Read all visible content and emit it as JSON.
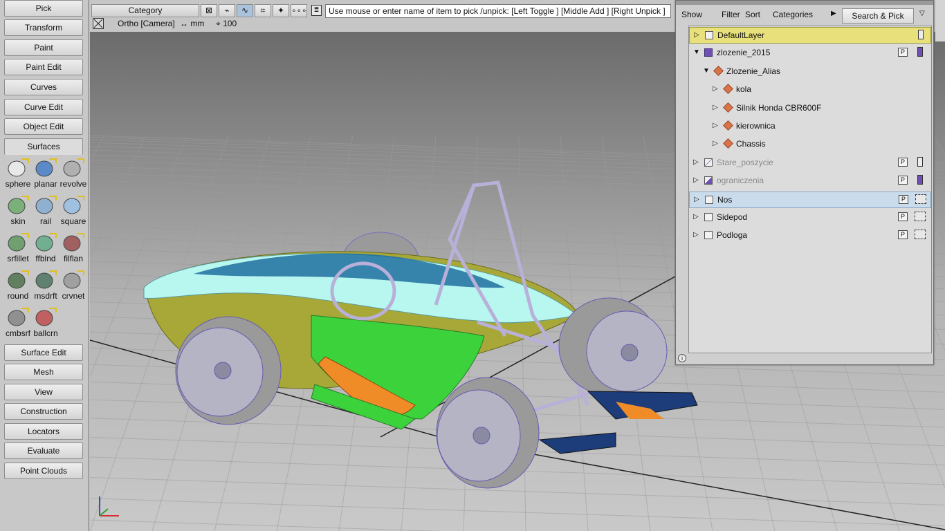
{
  "palette": {
    "buttons": [
      "Pick",
      "Transform",
      "Paint",
      "Paint Edit",
      "Curves",
      "Curve Edit",
      "Object Edit",
      "Surfaces",
      "Surface Edit",
      "Mesh",
      "View",
      "Construction",
      "Locators",
      "Evaluate",
      "Point Clouds"
    ],
    "active": "Surfaces",
    "tools": [
      "sphere",
      "planar",
      "revolve",
      "skin",
      "rail",
      "square",
      "srfillet",
      "ffblnd",
      "filflan",
      "round",
      "msdrft",
      "crvnet",
      "cmbsrf",
      "ballcrn"
    ]
  },
  "toolbar": {
    "category": "Category",
    "pick_message": "Use mouse or enter name of item to pick /unpick: [Left Toggle ] [Middle Add ] [Right Unpick ]",
    "icons": [
      "pick-object-icon",
      "pick-curve-icon",
      "pick-curve-active-icon",
      "pick-surface-icon",
      "pick-point-icon",
      "pick-cv-icon"
    ]
  },
  "viewport": {
    "camera": "Ortho [Camera]",
    "units": "↔ mm",
    "zoom": "100"
  },
  "lister": {
    "menu": [
      "Show",
      "Filter",
      "Sort",
      "Categories"
    ],
    "search_pick": "Search & Pick",
    "rows": [
      {
        "name": "DefaultLayer",
        "depth": 0,
        "type": "layer",
        "expanded": false,
        "state": "selected-yellow"
      },
      {
        "name": "zlozenie_2015",
        "depth": 0,
        "type": "layer",
        "expanded": true
      },
      {
        "name": "Zlozenie_Alias",
        "depth": 1,
        "type": "object",
        "expanded": true
      },
      {
        "name": "kola",
        "depth": 2,
        "type": "object",
        "expanded": false
      },
      {
        "name": "Silnik Honda CBR600F",
        "depth": 2,
        "type": "object",
        "expanded": false
      },
      {
        "name": "kierownica",
        "depth": 2,
        "type": "object",
        "expanded": false
      },
      {
        "name": "Chassis",
        "depth": 2,
        "type": "object",
        "expanded": false
      },
      {
        "name": "Stare_poszycie",
        "depth": 0,
        "type": "layer",
        "expanded": false,
        "state": "dimmed"
      },
      {
        "name": "ograniczenia",
        "depth": 0,
        "type": "layer",
        "expanded": false,
        "state": "dimmed"
      },
      {
        "name": "Nos",
        "depth": 0,
        "type": "layer",
        "expanded": false,
        "state": "selected-blue"
      },
      {
        "name": "Sidepod",
        "depth": 0,
        "type": "layer",
        "expanded": false
      },
      {
        "name": "Podloga",
        "depth": 0,
        "type": "layer",
        "expanded": false
      }
    ],
    "p_label": "P",
    "info_label": "i"
  },
  "colors": {
    "layer_selected": "#e8e07a",
    "row_selected": "#cadcec",
    "body_yellow": "#a8a838",
    "body_cyan": "#b8f6f0",
    "body_green": "#3cd23c",
    "body_orange": "#f08c28",
    "body_blue": "#1e6ea0",
    "wireframe": "#8c78c8"
  }
}
